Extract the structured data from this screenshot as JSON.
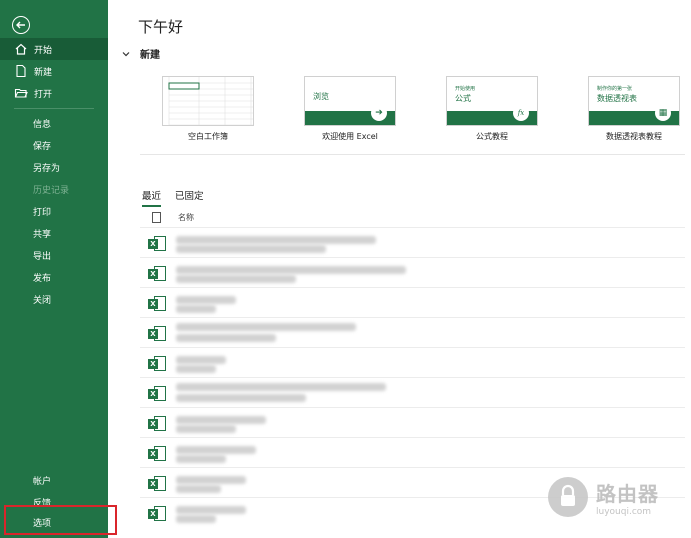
{
  "sidebar": {
    "items": [
      {
        "label": "开始",
        "icon": "home-icon",
        "active": true
      },
      {
        "label": "新建",
        "icon": "new-document-icon"
      },
      {
        "label": "打开",
        "icon": "open-folder-icon"
      },
      {
        "label": "信息"
      },
      {
        "label": "保存"
      },
      {
        "label": "另存为"
      },
      {
        "label": "历史记录",
        "disabled": true
      },
      {
        "label": "打印"
      },
      {
        "label": "共享"
      },
      {
        "label": "导出"
      },
      {
        "label": "发布"
      },
      {
        "label": "关闭"
      },
      {
        "label": "帐户"
      },
      {
        "label": "反馈"
      },
      {
        "label": "选项"
      }
    ],
    "accent_color": "#217346",
    "highlight_color": "#d9252b"
  },
  "main": {
    "greeting": "下午好",
    "new_section_title": "新建",
    "templates": [
      {
        "caption": "空白工作簿"
      },
      {
        "caption": "欢迎使用 Excel",
        "thumb_text": "浏览"
      },
      {
        "caption": "公式教程",
        "thumb_small": "开始使用",
        "thumb_big": "公式"
      },
      {
        "caption": "数据透视表教程",
        "thumb_small": "制作你的第一张",
        "thumb_big": "数据透视表"
      }
    ],
    "tabs": [
      {
        "label": "最近",
        "active": true
      },
      {
        "label": "已固定"
      }
    ],
    "column_header": "名称"
  },
  "watermark": {
    "title": "路由器",
    "subtitle": "luyouqi.com"
  }
}
